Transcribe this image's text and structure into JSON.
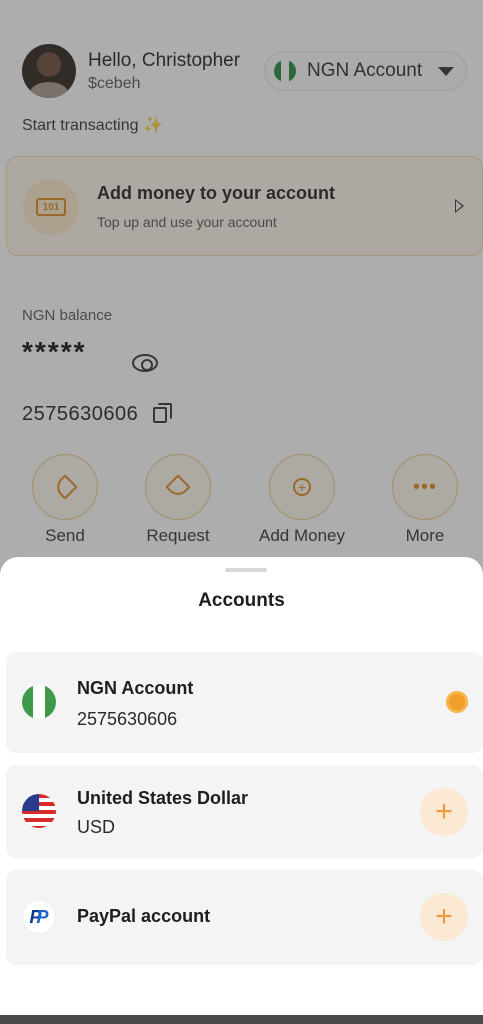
{
  "header": {
    "greeting": "Hello, Christopher",
    "username": "$cebeh",
    "account_selector": "NGN Account",
    "start_text": "Start transacting",
    "start_emoji": "✨"
  },
  "promo": {
    "title": "Add money to your account",
    "subtitle": "Top up and use your account"
  },
  "balance": {
    "label": "NGN balance",
    "value": "*****",
    "account_number": "2575630606"
  },
  "actions": [
    {
      "label": "Send"
    },
    {
      "label": "Request"
    },
    {
      "label": "Add Money"
    },
    {
      "label": "More"
    }
  ],
  "sheet": {
    "title": "Accounts",
    "accounts": [
      {
        "name": "NGN Account",
        "detail": "2575630606",
        "flag_icon": "nigeria-flag-icon",
        "selected": true
      },
      {
        "name": "United States Dollar",
        "detail": "USD",
        "flag_icon": "us-flag-icon",
        "selected": false
      },
      {
        "name": "PayPal account",
        "detail": "",
        "flag_icon": "paypal-icon",
        "selected": false
      }
    ]
  },
  "colors": {
    "accent": "#f0a02a",
    "accent_light": "#fbe9d3",
    "nigeria_green": "#1f8a3c"
  }
}
